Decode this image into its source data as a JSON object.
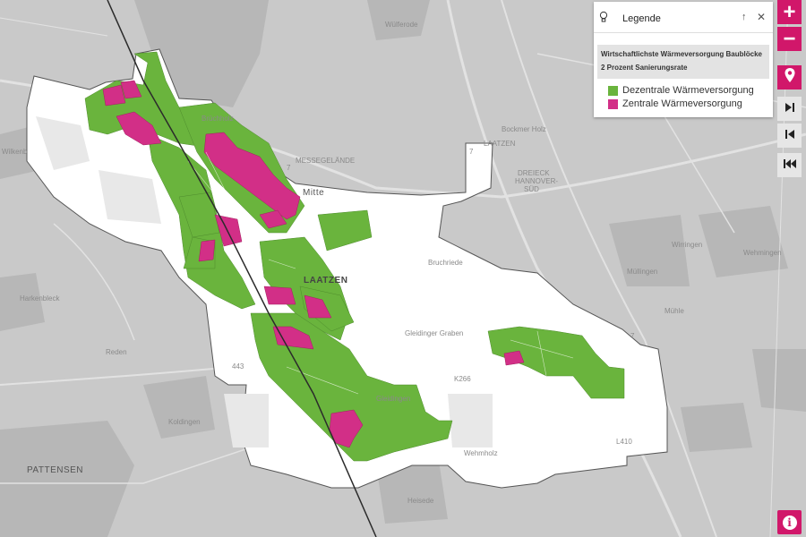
{
  "map": {
    "labels": {
      "wuelferode": "Wülferode",
      "buchholz": "Brüchholz",
      "messegelaende": "MESSEGELÄNDE",
      "mitte": "Mitte",
      "laatzen": "LAATZEN",
      "laatzen_road": "LAATZEN",
      "boeckmer_holz": "Bockmer Holz",
      "dreieck": "DREIECK",
      "hannover": "HANNOVER-",
      "sued": "SÜD",
      "wirringen": "Wirringen",
      "muellingen": "Müllingen",
      "wehmingen": "Wehmingen",
      "wilkenburg": "Wilkenb",
      "arnum": "Harkenbleck",
      "reden": "Reden",
      "koldingen": "Koldingen",
      "pattensen": "PATTENSEN",
      "gleidingen": "Gleidingen",
      "heisede": "Heisede",
      "wehmholz": "Wehmholz",
      "k266": "K266",
      "l410": "L410",
      "b443": "443",
      "a7a": "7",
      "a7b": "7",
      "a7c": "7",
      "muehle": "Mühle",
      "bruchriede": "Bruchriede",
      "gleidinger_graben": "Gleidinger Graben"
    }
  },
  "legend": {
    "title": "Legende",
    "subtitle_line1": "Wirtschaftlichste Wärmeversorgung Baublöcke",
    "subtitle_line2": "2 Prozent Sanierungsrate",
    "items": [
      {
        "label": "Dezentrale Wärmeversorgung",
        "color": "#6ab43d"
      },
      {
        "label": "Zentrale Wärmeversorgung",
        "color": "#d22f87"
      }
    ],
    "up_icon": "arrow-up-icon",
    "close_icon": "close-icon",
    "bulb_icon": "lightbulb-icon"
  },
  "controls": {
    "zoom_in": "+",
    "zoom_out": "−",
    "location_icon": "map-pin-icon",
    "next_icon": "skip-next-icon",
    "prev_icon": "skip-previous-icon",
    "first_icon": "skip-first-icon",
    "info_icon": "info-icon",
    "info": "i"
  },
  "colors": {
    "accent": "#d1176a",
    "green": "#6ab43d",
    "magenta": "#d22f87"
  }
}
